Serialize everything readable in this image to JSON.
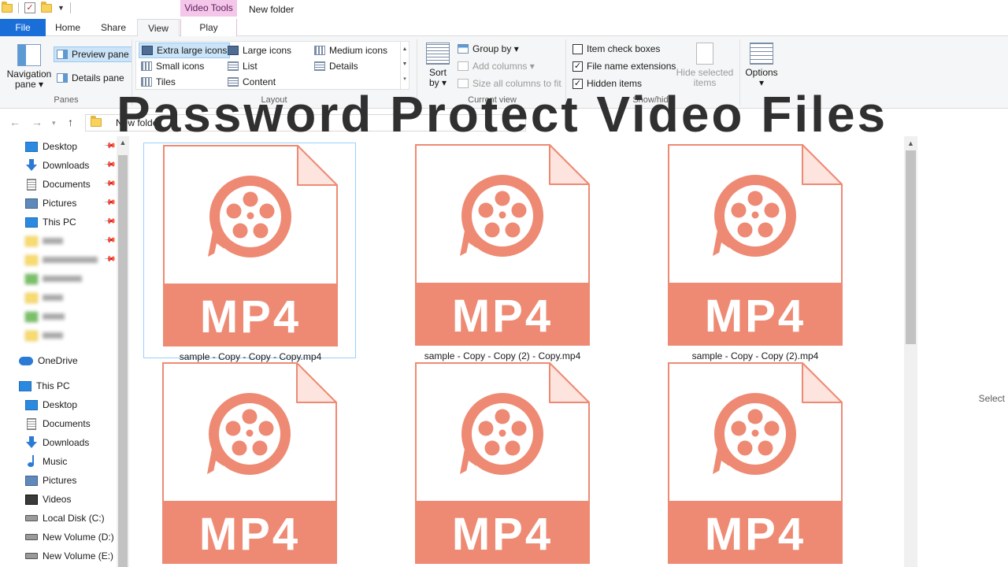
{
  "window": {
    "title": "New folder",
    "tools_tab": "Video Tools"
  },
  "overlay": {
    "title": "Password Protect Video Files"
  },
  "tabs": {
    "file": "File",
    "home": "Home",
    "share": "Share",
    "view": "View",
    "play": "Play"
  },
  "ribbon": {
    "panes": {
      "label": "Panes",
      "navigation_pane": "Navigation",
      "navigation_pane_2": "pane ▾",
      "preview_pane": "Preview pane",
      "details_pane": "Details pane"
    },
    "layout": {
      "label": "Layout",
      "extra_large_icons": "Extra large icons",
      "large_icons": "Large icons",
      "medium_icons": "Medium icons",
      "small_icons": "Small icons",
      "list": "List",
      "details": "Details",
      "tiles": "Tiles",
      "content": "Content"
    },
    "current_view": {
      "label": "Current view",
      "sort_by": "Sort",
      "sort_by_2": "by ▾",
      "group_by": "Group by ▾",
      "add_columns": "Add columns ▾",
      "size_columns": "Size all columns to fit"
    },
    "show_hide": {
      "label": "Show/hide",
      "item_check_boxes": "Item check boxes",
      "file_name_extensions": "File name extensions",
      "hidden_items": "Hidden items",
      "hide_selected": "Hide selected",
      "hide_selected_2": "items",
      "options": "Options",
      "options_2": "▾",
      "checks": {
        "item_check_boxes": false,
        "file_name_extensions": true,
        "hidden_items": true
      }
    }
  },
  "address": {
    "path": "New folder"
  },
  "sidebar": {
    "quick_access": [
      "Desktop",
      "Downloads",
      "Documents",
      "Pictures",
      "This PC"
    ],
    "onedrive": "OneDrive",
    "this_pc": "This PC",
    "pc_items": [
      "Desktop",
      "Documents",
      "Downloads",
      "Music",
      "Pictures",
      "Videos",
      "Local Disk (C:)",
      "New Volume (D:)",
      "New Volume (E:)"
    ]
  },
  "files": {
    "icon_label": "MP4",
    "names": [
      "sample - Copy - Copy - Copy.mp4",
      "sample - Copy - Copy (2) - Copy.mp4",
      "sample - Copy - Copy (2).mp4"
    ],
    "icon_color": "#ee8a73",
    "selected_color": "#99d1ff"
  },
  "preview": {
    "text": "Select"
  },
  "colors": {
    "accent": "#1a6ed8",
    "video_tools": "#f4c6ea",
    "mp4_fill": "#ee8a73"
  }
}
